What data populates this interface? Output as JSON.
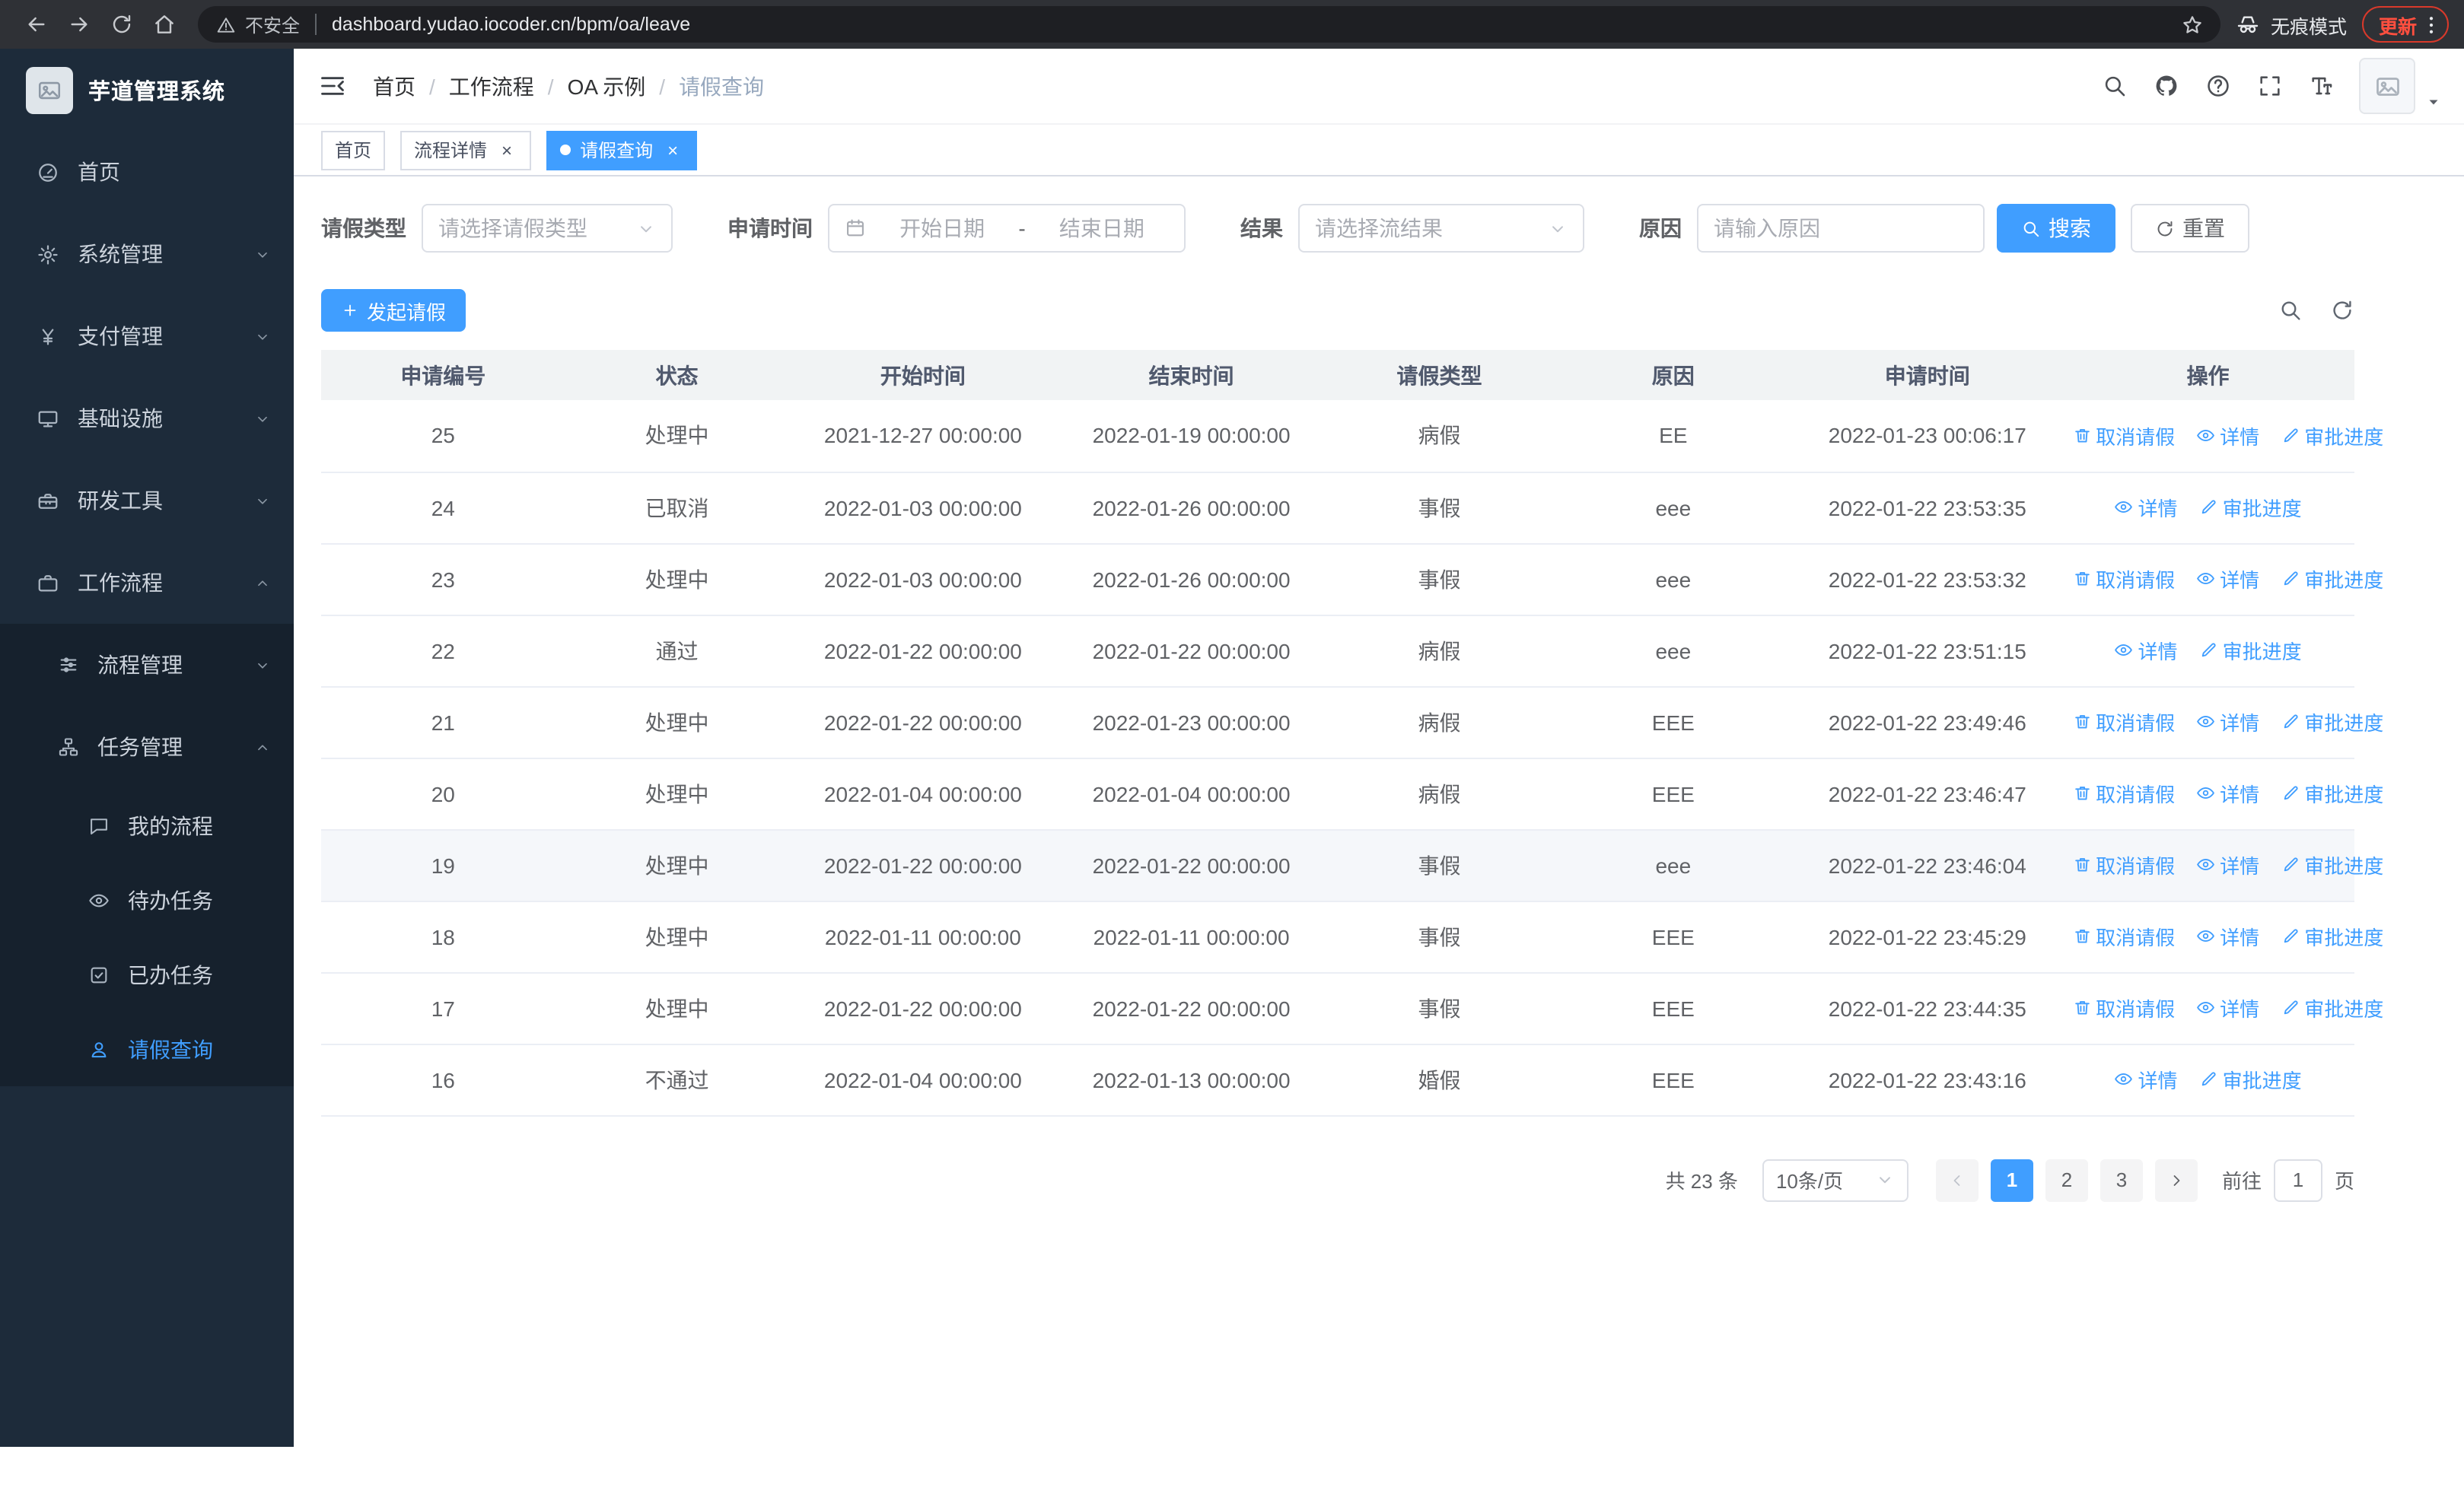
{
  "colors": {
    "primary": "#409EFF",
    "sidebar_bg": "#1D2B3A",
    "sidebar_sub_bg": "#16212D",
    "update_red": "#FF4F3F"
  },
  "icons": {
    "warning": "warning",
    "star": "star",
    "incognito": "incognito",
    "kebab": "kebab",
    "fold": "fold",
    "caret_down": "caret-down",
    "image_placeholder": "image",
    "calendar": "calendar",
    "chevron_down": "chevron-down",
    "chevron_left": "chevron-left",
    "chevron_right": "chevron-right",
    "search": "search",
    "refresh": "refresh",
    "plus": "plus"
  },
  "browser": {
    "security_label": "不安全",
    "url": "dashboard.yudao.iocoder.cn/bpm/oa/leave",
    "incognito_label": "无痕模式",
    "update_label": "更新",
    "buttons": [
      {
        "key": "back",
        "icon": "back"
      },
      {
        "key": "forward",
        "icon": "forward"
      },
      {
        "key": "reload",
        "icon": "reload"
      },
      {
        "key": "home",
        "icon": "home"
      }
    ]
  },
  "sidebar": {
    "app_title": "芋道管理系统",
    "items": [
      {
        "key": "home",
        "icon": "dashboard",
        "label": "首页"
      },
      {
        "key": "system-management",
        "icon": "gear",
        "label": "系统管理",
        "expandable": true
      },
      {
        "key": "payment-management",
        "icon": "yen",
        "label": "支付管理",
        "expandable": true
      },
      {
        "key": "infrastructure",
        "icon": "monitor",
        "label": "基础设施",
        "expandable": true
      },
      {
        "key": "dev-tools",
        "icon": "toolbox",
        "label": "研发工具",
        "expandable": true
      },
      {
        "key": "workflow",
        "icon": "briefcase",
        "label": "工作流程",
        "expandable": true,
        "expanded": true,
        "children": [
          {
            "key": "process-management",
            "icon": "sliders",
            "label": "流程管理",
            "expandable": true
          },
          {
            "key": "task-management",
            "icon": "sitemap",
            "label": "任务管理",
            "expandable": true,
            "expanded": true,
            "children": [
              {
                "key": "my-process",
                "icon": "chat",
                "label": "我的流程"
              },
              {
                "key": "todo-task",
                "icon": "eye",
                "label": "待办任务"
              },
              {
                "key": "done-task",
                "icon": "check-square",
                "label": "已办任务"
              },
              {
                "key": "leave-query",
                "icon": "user",
                "label": "请假查询",
                "active": true
              }
            ]
          }
        ]
      }
    ]
  },
  "header": {
    "breadcrumb": [
      "首页",
      "工作流程",
      "OA 示例",
      "请假查询"
    ],
    "tools": [
      {
        "key": "header-search",
        "icon": "search"
      },
      {
        "key": "github",
        "icon": "github"
      },
      {
        "key": "help",
        "icon": "question"
      },
      {
        "key": "fullscreen",
        "icon": "fullscreen"
      },
      {
        "key": "font-size",
        "icon": "fontsize"
      }
    ]
  },
  "tabs": [
    {
      "key": "home",
      "label": "首页",
      "closable": false,
      "active": false
    },
    {
      "key": "process-detail",
      "label": "流程详情",
      "closable": true,
      "active": false
    },
    {
      "key": "leave-query",
      "label": "请假查询",
      "closable": true,
      "active": true
    }
  ],
  "filters": {
    "leave_type_label": "请假类型",
    "leave_type_placeholder": "请选择请假类型",
    "apply_time_label": "申请时间",
    "start_date_placeholder": "开始日期",
    "range_separator": "-",
    "end_date_placeholder": "结束日期",
    "result_label": "结果",
    "result_placeholder": "请选择流结果",
    "reason_label": "原因",
    "reason_placeholder": "请输入原因",
    "search_label": "搜索",
    "reset_label": "重置"
  },
  "toolbar": {
    "create_label": "发起请假",
    "tools": [
      {
        "key": "toggle-search",
        "icon": "search"
      },
      {
        "key": "refresh-table",
        "icon": "refresh"
      }
    ]
  },
  "table": {
    "columns": [
      "申请编号",
      "状态",
      "开始时间",
      "结束时间",
      "请假类型",
      "原因",
      "申请时间",
      "操作"
    ],
    "action_labels": {
      "cancel": "取消请假",
      "detail": "详情",
      "progress": "审批进度"
    },
    "action_icons": {
      "cancel": "trash",
      "detail": "eye",
      "progress": "edit"
    },
    "rows": [
      {
        "id": "25",
        "status": "处理中",
        "start": "2021-12-27 00:00:00",
        "end": "2022-01-19 00:00:00",
        "type": "病假",
        "reason": "EE",
        "applied": "2022-01-23 00:06:17",
        "actions": [
          "cancel",
          "detail",
          "progress"
        ]
      },
      {
        "id": "24",
        "status": "已取消",
        "start": "2022-01-03 00:00:00",
        "end": "2022-01-26 00:00:00",
        "type": "事假",
        "reason": "eee",
        "applied": "2022-01-22 23:53:35",
        "actions": [
          "detail",
          "progress"
        ]
      },
      {
        "id": "23",
        "status": "处理中",
        "start": "2022-01-03 00:00:00",
        "end": "2022-01-26 00:00:00",
        "type": "事假",
        "reason": "eee",
        "applied": "2022-01-22 23:53:32",
        "actions": [
          "cancel",
          "detail",
          "progress"
        ]
      },
      {
        "id": "22",
        "status": "通过",
        "start": "2022-01-22 00:00:00",
        "end": "2022-01-22 00:00:00",
        "type": "病假",
        "reason": "eee",
        "applied": "2022-01-22 23:51:15",
        "actions": [
          "detail",
          "progress"
        ]
      },
      {
        "id": "21",
        "status": "处理中",
        "start": "2022-01-22 00:00:00",
        "end": "2022-01-23 00:00:00",
        "type": "病假",
        "reason": "EEE",
        "applied": "2022-01-22 23:49:46",
        "actions": [
          "cancel",
          "detail",
          "progress"
        ]
      },
      {
        "id": "20",
        "status": "处理中",
        "start": "2022-01-04 00:00:00",
        "end": "2022-01-04 00:00:00",
        "type": "病假",
        "reason": "EEE",
        "applied": "2022-01-22 23:46:47",
        "actions": [
          "cancel",
          "detail",
          "progress"
        ]
      },
      {
        "id": "19",
        "status": "处理中",
        "start": "2022-01-22 00:00:00",
        "end": "2022-01-22 00:00:00",
        "type": "事假",
        "reason": "eee",
        "applied": "2022-01-22 23:46:04",
        "actions": [
          "cancel",
          "detail",
          "progress"
        ],
        "highlighted": true
      },
      {
        "id": "18",
        "status": "处理中",
        "start": "2022-01-11 00:00:00",
        "end": "2022-01-11 00:00:00",
        "type": "事假",
        "reason": "EEE",
        "applied": "2022-01-22 23:45:29",
        "actions": [
          "cancel",
          "detail",
          "progress"
        ]
      },
      {
        "id": "17",
        "status": "处理中",
        "start": "2022-01-22 00:00:00",
        "end": "2022-01-22 00:00:00",
        "type": "事假",
        "reason": "EEE",
        "applied": "2022-01-22 23:44:35",
        "actions": [
          "cancel",
          "detail",
          "progress"
        ]
      },
      {
        "id": "16",
        "status": "不通过",
        "start": "2022-01-04 00:00:00",
        "end": "2022-01-13 00:00:00",
        "type": "婚假",
        "reason": "EEE",
        "applied": "2022-01-22 23:43:16",
        "actions": [
          "detail",
          "progress"
        ]
      }
    ]
  },
  "pagination": {
    "total_label": "共 23 条",
    "page_size": "10条/页",
    "pages": [
      "1",
      "2",
      "3"
    ],
    "active_page": "1",
    "goto_label": "前往",
    "goto_value": "1",
    "page_unit": "页"
  }
}
